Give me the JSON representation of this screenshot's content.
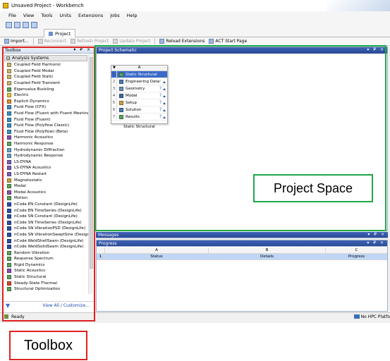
{
  "window": {
    "title": "Unsaved Project - Workbench"
  },
  "menu": [
    "File",
    "View",
    "Tools",
    "Units",
    "Extensions",
    "Jobs",
    "Help"
  ],
  "tab": {
    "label": "Project"
  },
  "toolbar": {
    "import": "Import...",
    "reconnect": "Reconnect",
    "refresh": "Refresh Project",
    "update": "Update Project",
    "reload": "Reload Extensions",
    "act": "ACT Start Page"
  },
  "toolbox": {
    "title": "Toolbox",
    "controls": "▾ ₽ ×",
    "section": "Analysis Systems",
    "items": [
      {
        "label": "Coupled Field Harmonic",
        "color": "#c9b46a"
      },
      {
        "label": "Coupled Field Modal",
        "color": "#c9b46a"
      },
      {
        "label": "Coupled Field Static",
        "color": "#c9b46a"
      },
      {
        "label": "Coupled Field Transient",
        "color": "#c9b46a"
      },
      {
        "label": "Eigenvalue Buckling",
        "color": "#5aa55a"
      },
      {
        "label": "Electric",
        "color": "#e0c040"
      },
      {
        "label": "Explicit Dynamics",
        "color": "#e08a2a"
      },
      {
        "label": "Fluid Flow (CFX)",
        "color": "#3c8fc4"
      },
      {
        "label": "Fluid Flow (Fluent with Fluent Meshing)",
        "color": "#3c8fc4"
      },
      {
        "label": "Fluid Flow (Fluent)",
        "color": "#3c8fc4"
      },
      {
        "label": "Fluid Flow (Polyflow Classic)",
        "color": "#3c8fc4"
      },
      {
        "label": "Fluid Flow (Polyflow) (Beta)",
        "color": "#3c8fc4"
      },
      {
        "label": "Harmonic Acoustics",
        "color": "#8a4fb5"
      },
      {
        "label": "Harmonic Response",
        "color": "#5aa55a"
      },
      {
        "label": "Hydrodynamic Diffraction",
        "color": "#6aa0c8"
      },
      {
        "label": "Hydrodynamic Response",
        "color": "#6aa0c8"
      },
      {
        "label": "LS-DYNA",
        "color": "#7a5fb5"
      },
      {
        "label": "LS-DYNA Acoustics",
        "color": "#7a5fb5"
      },
      {
        "label": "LS-DYNA Restart",
        "color": "#7a5fb5"
      },
      {
        "label": "Magnetostatic",
        "color": "#c8a040"
      },
      {
        "label": "Modal",
        "color": "#5aa55a"
      },
      {
        "label": "Modal Acoustics",
        "color": "#8a4fb5"
      },
      {
        "label": "Motion",
        "color": "#5aa55a"
      },
      {
        "label": "nCode EN Constant (DesignLife)",
        "color": "#2a4fa8"
      },
      {
        "label": "nCode EN TimeSeries (DesignLife)",
        "color": "#2a4fa8"
      },
      {
        "label": "nCode SN Constant (DesignLife)",
        "color": "#2a4fa8"
      },
      {
        "label": "nCode SN TimeSeries (DesignLife)",
        "color": "#2a4fa8"
      },
      {
        "label": "nCode SN VibrationPSD (DesignLife)",
        "color": "#2a4fa8"
      },
      {
        "label": "nCode SN VibrationSweptSine (DesignLife)",
        "color": "#2a4fa8"
      },
      {
        "label": "nCode WeldShellSeam (DesignLife)",
        "color": "#2a4fa8"
      },
      {
        "label": "nCode WeldSolidSeam (DesignLife)",
        "color": "#2a4fa8"
      },
      {
        "label": "Random Vibration",
        "color": "#5aa55a"
      },
      {
        "label": "Response Spectrum",
        "color": "#5aa55a"
      },
      {
        "label": "Rigid Dynamics",
        "color": "#5aa55a"
      },
      {
        "label": "Static Acoustics",
        "color": "#8a4fb5"
      },
      {
        "label": "Static Structural",
        "color": "#5aa55a"
      },
      {
        "label": "Steady-State Thermal",
        "color": "#d04a2a"
      },
      {
        "label": "Structural Optimization",
        "color": "#5aa55a"
      }
    ],
    "view_all": "View All / Customize..."
  },
  "schematic": {
    "title": "Project Schematic",
    "controls": "▾ ₽ ×",
    "system": {
      "column": "A",
      "name": "Static Structural",
      "rows": [
        {
          "n": "1",
          "label": "Static Structural",
          "icon_color": "#5aa55a",
          "status": ""
        },
        {
          "n": "2",
          "label": "Engineering Data",
          "icon_color": "#4a7bb5",
          "status": "✓"
        },
        {
          "n": "3",
          "label": "Geometry",
          "icon_color": "#6a8fb5",
          "status": "?"
        },
        {
          "n": "4",
          "label": "Model",
          "icon_color": "#3a6aa8",
          "status": "?"
        },
        {
          "n": "5",
          "label": "Setup",
          "icon_color": "#c8a040",
          "status": "?"
        },
        {
          "n": "6",
          "label": "Solution",
          "icon_color": "#4a7bb5",
          "status": "?"
        },
        {
          "n": "7",
          "label": "Results",
          "icon_color": "#5aa55a",
          "status": "?"
        }
      ]
    }
  },
  "annotations": {
    "project_space": "Project Space",
    "toolbox": "Toolbox"
  },
  "messages": {
    "title": "Messages",
    "controls": "▾ ₽ ×"
  },
  "progress": {
    "title": "Progress",
    "controls": "▾ ₽ ×",
    "columns": [
      "",
      "A",
      "B",
      "C"
    ],
    "row": [
      "1",
      "Status",
      "Details",
      "Progress"
    ]
  },
  "status": {
    "text": "Ready",
    "hpc": "No HPC Platfo"
  }
}
